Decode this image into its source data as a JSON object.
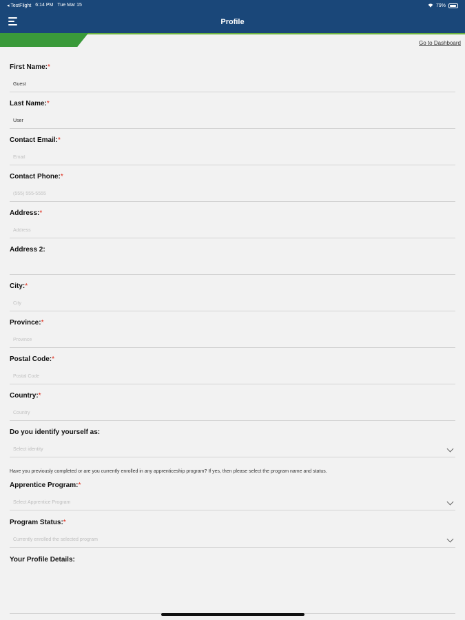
{
  "status_bar": {
    "back_app": "◂ TestFlight",
    "time": "6:14 PM",
    "date": "Tue Mar 15",
    "battery_text": "79%",
    "battery_level": 0.79
  },
  "header": {
    "title": "Profile",
    "menu_icon": "hamburger-menu-icon"
  },
  "progress": {
    "fraction": 0.19
  },
  "dashboard_link": "Go to Dashboard",
  "fields": [
    {
      "label": "First Name:",
      "required": true,
      "value": "Guest",
      "placeholder": ""
    },
    {
      "label": "Last Name:",
      "required": true,
      "value": "User",
      "placeholder": ""
    },
    {
      "label": "Contact Email:",
      "required": true,
      "value": "",
      "placeholder": "Email"
    },
    {
      "label": "Contact Phone:",
      "required": true,
      "value": "",
      "placeholder": "(555) 555-5555"
    },
    {
      "label": "Address:",
      "required": true,
      "value": "",
      "placeholder": "Address"
    },
    {
      "label": "Address 2:",
      "required": false,
      "value": "",
      "placeholder": ""
    },
    {
      "label": "City:",
      "required": true,
      "value": "",
      "placeholder": "City"
    },
    {
      "label": "Province:",
      "required": true,
      "value": "",
      "placeholder": "Province"
    },
    {
      "label": "Postal Code:",
      "required": true,
      "value": "",
      "placeholder": "Postal Code"
    },
    {
      "label": "Country:",
      "required": true,
      "value": "",
      "placeholder": "Country"
    }
  ],
  "identity": {
    "label": "Do you identify yourself as:",
    "placeholder": "Select identity"
  },
  "helper_text": "Have you previously completed or are you currently enrolled in any apprenticeship program? If yes, then please select the program name and status.",
  "apprentice_program": {
    "label": "Apprentice Program:",
    "required": true,
    "placeholder": "Select Apprentice Program"
  },
  "program_status": {
    "label": "Program Status:",
    "required": true,
    "placeholder": "Currently enrolled the selected program"
  },
  "profile_details": {
    "label": "Your Profile Details:"
  },
  "colors": {
    "header_bg": "#1a4779",
    "progress_green": "#6cb33f",
    "required_red": "#dd2211",
    "page_bg": "#f2f2f2"
  }
}
